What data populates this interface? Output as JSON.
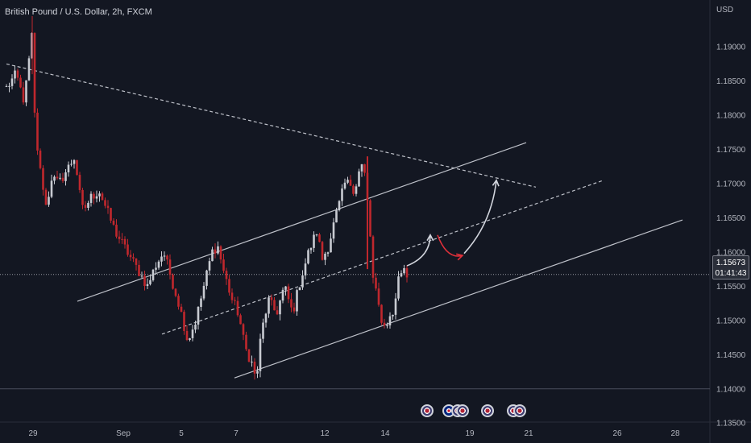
{
  "header": {
    "title": "British Pound / U.S. Dollar, 2h, FXCM",
    "currency": "USD"
  },
  "price_tag": {
    "price": "1.15673",
    "countdown": "01:41:43"
  },
  "colors": {
    "background": "#131722",
    "up_candle": "#c8cbd2",
    "down_candle": "#c0272d",
    "trendline": "#d1d4dc",
    "arrow_red": "#e0303a"
  },
  "event_icons": [
    "us-flag-icon",
    "uk-flag-icon",
    "us-flag-icon",
    "us-flag-icon",
    "us-flag-icon",
    "us-flag-icon",
    "us-flag-icon"
  ],
  "chart_data": {
    "type": "candlestick",
    "symbol": "GBPUSD",
    "current_price": 1.15673,
    "ylim": [
      1.1355,
      1.1945
    ],
    "y_ticks": [
      "1.13500",
      "1.14000",
      "1.14500",
      "1.15000",
      "1.15500",
      "1.16000",
      "1.16500",
      "1.17000",
      "1.17500",
      "1.18000",
      "1.18500",
      "1.19000"
    ],
    "x_ticks": [
      {
        "label": "29",
        "t": 3
      },
      {
        "label": "Sep",
        "t": 115
      },
      {
        "label": "5",
        "t": 187
      },
      {
        "label": "7",
        "t": 255
      },
      {
        "label": "12",
        "t": 365
      },
      {
        "label": "14",
        "t": 440
      },
      {
        "label": "19",
        "t": 545
      },
      {
        "label": "21",
        "t": 618
      },
      {
        "label": "26",
        "t": 728
      },
      {
        "label": "28",
        "t": 800
      }
    ],
    "anchors": [
      [
        -30,
        1.184
      ],
      [
        -18,
        1.186
      ],
      [
        -8,
        1.182
      ],
      [
        -2,
        1.188
      ],
      [
        2,
        1.192
      ],
      [
        5,
        1.18
      ],
      [
        10,
        1.173
      ],
      [
        15,
        1.17
      ],
      [
        20,
        1.166
      ],
      [
        25,
        1.171
      ],
      [
        35,
        1.17
      ],
      [
        45,
        1.172
      ],
      [
        55,
        1.174
      ],
      [
        60,
        1.169
      ],
      [
        65,
        1.166
      ],
      [
        75,
        1.168
      ],
      [
        85,
        1.169
      ],
      [
        95,
        1.166
      ],
      [
        105,
        1.163
      ],
      [
        115,
        1.161
      ],
      [
        125,
        1.159
      ],
      [
        135,
        1.157
      ],
      [
        145,
        1.155
      ],
      [
        155,
        1.158
      ],
      [
        165,
        1.16
      ],
      [
        175,
        1.156
      ],
      [
        185,
        1.152
      ],
      [
        195,
        1.147
      ],
      [
        205,
        1.15
      ],
      [
        215,
        1.155
      ],
      [
        225,
        1.16
      ],
      [
        232,
        1.161
      ],
      [
        240,
        1.157
      ],
      [
        250,
        1.153
      ],
      [
        258,
        1.151
      ],
      [
        266,
        1.146
      ],
      [
        274,
        1.144
      ],
      [
        280,
        1.141
      ],
      [
        286,
        1.148
      ],
      [
        295,
        1.153
      ],
      [
        305,
        1.151
      ],
      [
        315,
        1.155
      ],
      [
        325,
        1.151
      ],
      [
        335,
        1.156
      ],
      [
        345,
        1.16
      ],
      [
        355,
        1.163
      ],
      [
        362,
        1.159
      ],
      [
        370,
        1.161
      ],
      [
        378,
        1.165
      ],
      [
        383,
        1.167
      ],
      [
        390,
        1.17
      ],
      [
        397,
        1.17
      ],
      [
        402,
        1.169
      ],
      [
        408,
        1.172
      ],
      [
        413,
        1.173
      ],
      [
        420,
        1.165
      ],
      [
        425,
        1.156
      ],
      [
        432,
        1.152
      ],
      [
        438,
        1.149
      ],
      [
        444,
        1.15
      ],
      [
        450,
        1.151
      ],
      [
        456,
        1.156
      ],
      [
        463,
        1.158
      ],
      [
        467,
        1.1567
      ]
    ],
    "drawings": {
      "descending_resistance": [
        [
          -30,
          1.1875
        ],
        [
          627,
          1.1695
        ]
      ],
      "upper_channel": [
        [
          58,
          1.1528
        ],
        [
          615,
          1.176
        ]
      ],
      "median_channel": [
        [
          163,
          1.148
        ],
        [
          711,
          1.1705
        ]
      ],
      "lower_channel": [
        [
          253,
          1.1416
        ],
        [
          809,
          1.1647
        ]
      ],
      "current_price_line": 1.15673
    },
    "projection_arrows": [
      {
        "color": "white",
        "from": [
          467,
          1.158
        ],
        "to": [
          496,
          1.1625
        ]
      },
      {
        "color": "red",
        "from": [
          505,
          1.1625
        ],
        "to": [
          536,
          1.1595
        ]
      },
      {
        "color": "white",
        "from": [
          538,
          1.1598
        ],
        "to": [
          578,
          1.1705
        ]
      }
    ]
  }
}
